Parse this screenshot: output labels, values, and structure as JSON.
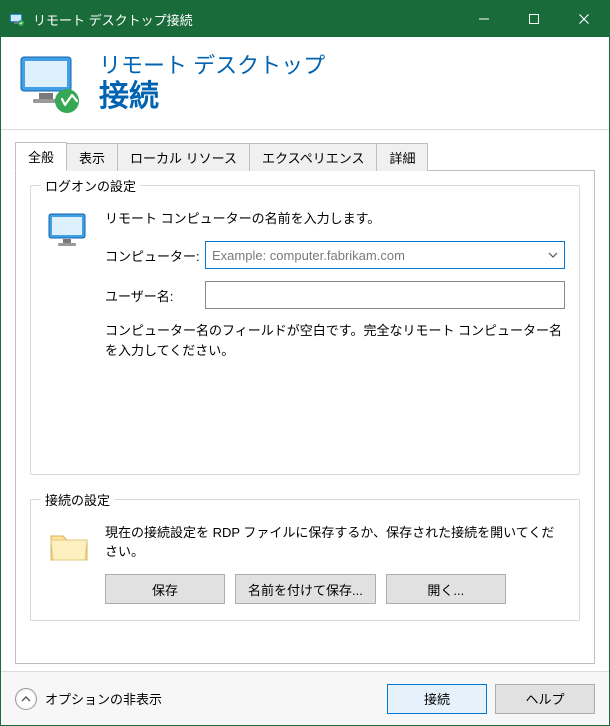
{
  "window": {
    "title": "リモート デスクトップ接続"
  },
  "header": {
    "line1": "リモート デスクトップ",
    "line2": "接続"
  },
  "tabs": {
    "general": "全般",
    "display": "表示",
    "local_resources": "ローカル リソース",
    "experience": "エクスペリエンス",
    "advanced": "詳細"
  },
  "logon": {
    "legend": "ログオンの設定",
    "prompt": "リモート コンピューターの名前を入力します。",
    "computer_label": "コンピューター:",
    "computer_placeholder": "Example: computer.fabrikam.com",
    "computer_value": "",
    "username_label": "ユーザー名:",
    "username_value": "",
    "hint": "コンピューター名のフィールドが空白です。完全なリモート コンピューター名を入力してください。"
  },
  "connection": {
    "legend": "接続の設定",
    "description": "現在の接続設定を RDP ファイルに保存するか、保存された接続を開いてください。",
    "save": "保存",
    "save_as": "名前を付けて保存...",
    "open": "開く..."
  },
  "footer": {
    "options_label": "オプションの非表示",
    "connect": "接続",
    "help": "ヘルプ"
  }
}
